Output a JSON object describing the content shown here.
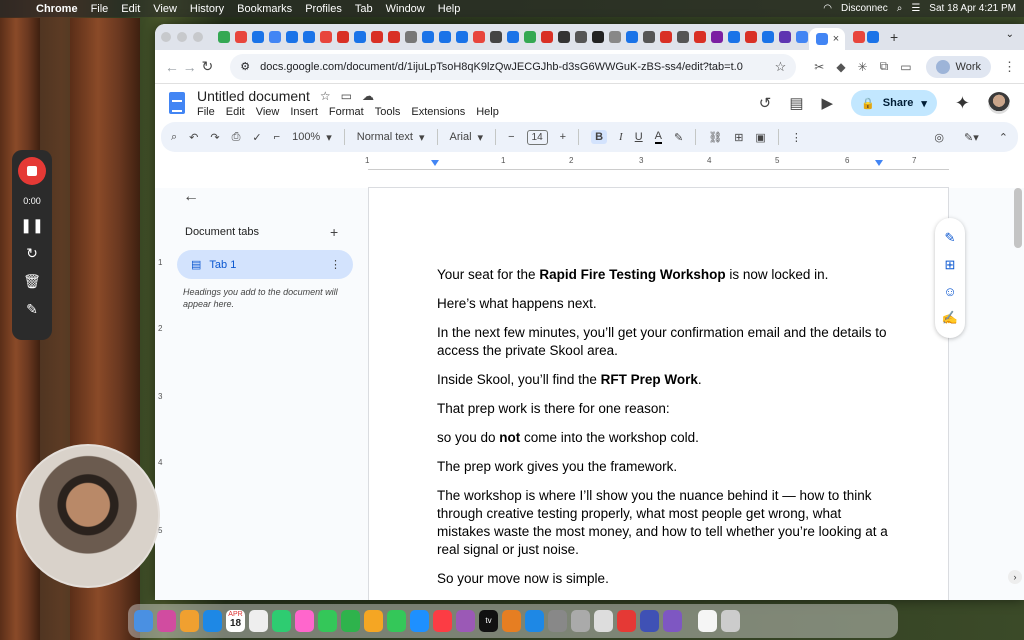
{
  "menubar": {
    "app": "Chrome",
    "items": [
      "File",
      "Edit",
      "View",
      "History",
      "Bookmarks",
      "Profiles",
      "Tab",
      "Window",
      "Help"
    ],
    "status": {
      "vpn": "Disconnec",
      "datetime": "Sat 18 Apr  4:21 PM"
    }
  },
  "browser": {
    "url": "docs.google.com/document/d/1ijuLpTsoH8qK9lzQwJECGJhb-d3sG6WWGuK-zBS-ss4/edit?tab=t.0",
    "profile_label": "Work",
    "tab_close": "×",
    "new_tab": "+"
  },
  "doc": {
    "title": "Untitled document",
    "menus": [
      "File",
      "Edit",
      "View",
      "Insert",
      "Format",
      "Tools",
      "Extensions",
      "Help"
    ],
    "share_label": "Share"
  },
  "toolbar": {
    "zoom": "100%",
    "style": "Normal text",
    "font": "Arial",
    "font_size": "14",
    "bold": "B",
    "italic": "I",
    "underline": "U",
    "text_color": "A"
  },
  "ruler": [
    "1",
    "1",
    "2",
    "3",
    "4",
    "5",
    "6",
    "7"
  ],
  "vruler": [
    "1",
    "2",
    "3",
    "4",
    "5"
  ],
  "sidepanel": {
    "title": "Document tabs",
    "tab_label": "Tab 1",
    "hint": "Headings you add to the document will appear here."
  },
  "body": [
    {
      "parts": [
        "Your seat for the ",
        "Rapid Fire Testing Workshop",
        " is now locked in."
      ]
    },
    {
      "text": "Here’s what happens next."
    },
    {
      "text": "In the next few minutes, you’ll get your confirmation email and the details to access the private Skool area."
    },
    {
      "parts": [
        "Inside Skool, you’ll find the ",
        "RFT Prep Work",
        "."
      ]
    },
    {
      "text": "That prep work is there for one reason:"
    },
    {
      "parts": [
        "so you do ",
        "not",
        " come into the workshop cold."
      ]
    },
    {
      "text": "The prep work gives you the framework."
    },
    {
      "text": "The workshop is where I’ll show you the nuance behind it — how to think through creative testing properly, what most people get wrong, what mistakes waste the most money, and how to tell whether you’re looking at a real signal or just noise."
    },
    {
      "text": "So your move now is simple."
    }
  ],
  "recorder": {
    "time": "0:00"
  },
  "dock": {
    "calendar_day": "18",
    "calendar_month": "APR",
    "tv_label": "tv"
  },
  "colors": {
    "accent": "#0b57d0",
    "share_bg": "#c2e7ff",
    "record": "#e53935"
  }
}
